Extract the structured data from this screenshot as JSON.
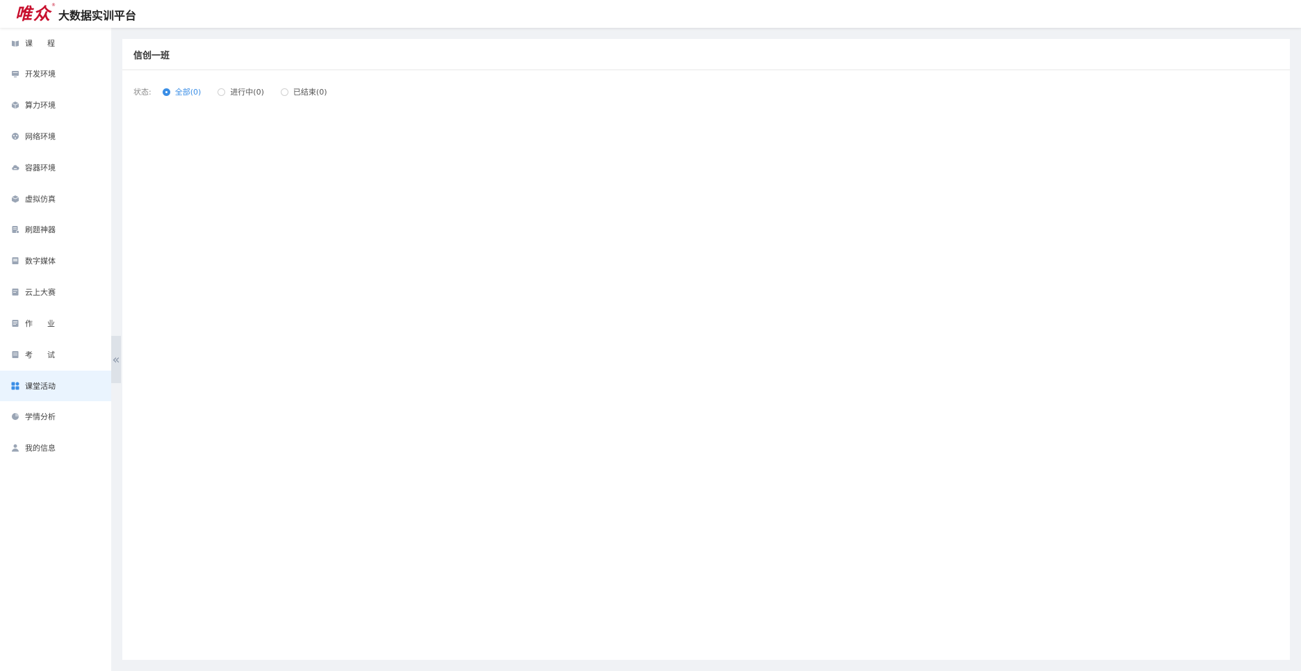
{
  "header": {
    "brand": "唯众",
    "registered": "®",
    "title": "大数据实训平台"
  },
  "sidebar": {
    "items": [
      {
        "label": "课程",
        "icon": "book-icon",
        "active": false
      },
      {
        "label": "开发环境",
        "icon": "monitor-icon",
        "active": false
      },
      {
        "label": "算力环境",
        "icon": "cube-icon",
        "active": false
      },
      {
        "label": "网络环境",
        "icon": "network-icon",
        "active": false
      },
      {
        "label": "容器环境",
        "icon": "cloud-icon",
        "active": false
      },
      {
        "label": "虚拟仿真",
        "icon": "box-icon",
        "active": false
      },
      {
        "label": "刷题神器",
        "icon": "quiz-icon",
        "active": false
      },
      {
        "label": "数字媒体",
        "icon": "media-icon",
        "active": false
      },
      {
        "label": "云上大赛",
        "icon": "competition-icon",
        "active": false
      },
      {
        "label": "作业",
        "icon": "homework-icon",
        "active": false
      },
      {
        "label": "考试",
        "icon": "exam-icon",
        "active": false
      },
      {
        "label": "课堂活动",
        "icon": "grid-icon",
        "active": true
      },
      {
        "label": "学情分析",
        "icon": "pie-chart-icon",
        "active": false
      },
      {
        "label": "我的信息",
        "icon": "user-icon",
        "active": false
      }
    ],
    "collapse_glyph": "«"
  },
  "main": {
    "title": "信创一班",
    "status_label": "状态:",
    "filters": [
      {
        "label": "全部(0)",
        "checked": true
      },
      {
        "label": "进行中(0)",
        "checked": false
      },
      {
        "label": "已结束(0)",
        "checked": false
      }
    ]
  },
  "colors": {
    "accent": "#3a8ee6",
    "brand": "#c8102e",
    "active_bg": "#eaf4fe",
    "page_bg": "#f0f2f5"
  }
}
